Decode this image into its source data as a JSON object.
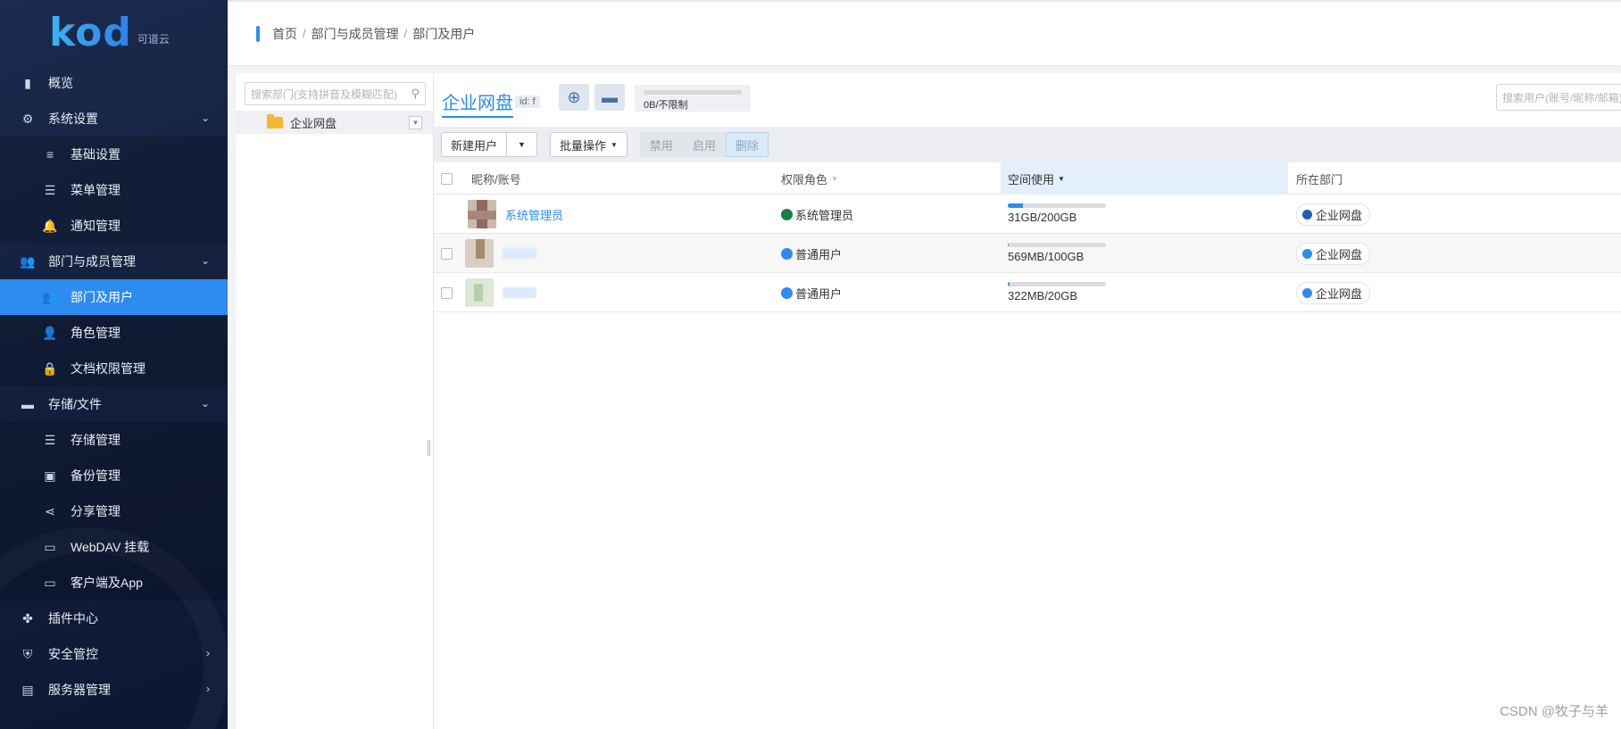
{
  "app": {
    "logo_word": "kod",
    "logo_sub": "可道云"
  },
  "sidebar": {
    "items": [
      {
        "label": "概览",
        "icon": "bar-chart-icon",
        "glyph": "▮",
        "sub": false,
        "active": false,
        "caret": ""
      },
      {
        "label": "系统设置",
        "icon": "gear-icon",
        "glyph": "⚙",
        "sub": false,
        "active": false,
        "caret": "⌄"
      },
      {
        "label": "基础设置",
        "icon": "sliders-icon",
        "glyph": "≡",
        "sub": true,
        "active": false,
        "caret": ""
      },
      {
        "label": "菜单管理",
        "icon": "menu-list-icon",
        "glyph": "☰",
        "sub": true,
        "active": false,
        "caret": ""
      },
      {
        "label": "通知管理",
        "icon": "bell-icon",
        "glyph": "🔔",
        "sub": true,
        "active": false,
        "caret": ""
      },
      {
        "label": "部门与成员管理",
        "icon": "users-icon",
        "glyph": "👥",
        "sub": false,
        "active": false,
        "caret": "⌄"
      },
      {
        "label": "部门及用户",
        "icon": "user-group-icon",
        "glyph": "👥",
        "sub": true,
        "active": true,
        "caret": ""
      },
      {
        "label": "角色管理",
        "icon": "role-user-icon",
        "glyph": "👤",
        "sub": true,
        "active": false,
        "caret": ""
      },
      {
        "label": "文档权限管理",
        "icon": "lock-icon",
        "glyph": "🔒",
        "sub": true,
        "active": false,
        "caret": ""
      },
      {
        "label": "存储/文件",
        "icon": "folder-icon",
        "glyph": "▬",
        "sub": false,
        "active": false,
        "caret": "⌄"
      },
      {
        "label": "存储管理",
        "icon": "database-icon",
        "glyph": "☰",
        "sub": true,
        "active": false,
        "caret": ""
      },
      {
        "label": "备份管理",
        "icon": "backup-icon",
        "glyph": "▣",
        "sub": true,
        "active": false,
        "caret": ""
      },
      {
        "label": "分享管理",
        "icon": "share-icon",
        "glyph": "⋖",
        "sub": true,
        "active": false,
        "caret": ""
      },
      {
        "label": "WebDAV 挂载",
        "icon": "drive-icon",
        "glyph": "▭",
        "sub": true,
        "active": false,
        "caret": ""
      },
      {
        "label": "客户端及App",
        "icon": "monitor-icon",
        "glyph": "▭",
        "sub": true,
        "active": false,
        "caret": ""
      },
      {
        "label": "插件中心",
        "icon": "plugin-icon",
        "glyph": "✤",
        "sub": false,
        "active": false,
        "caret": ""
      },
      {
        "label": "安全管控",
        "icon": "shield-icon",
        "glyph": "⛨",
        "sub": false,
        "active": false,
        "caret": "›"
      },
      {
        "label": "服务器管理",
        "icon": "server-icon",
        "glyph": "▤",
        "sub": false,
        "active": false,
        "caret": "›"
      }
    ]
  },
  "breadcrumb": {
    "items": [
      "首页",
      "部门与成员管理",
      "部门及用户"
    ],
    "separator": "/"
  },
  "tree": {
    "search_placeholder": "搜索部门(支持拼音及模糊匹配)",
    "root_label": "企业网盘"
  },
  "group": {
    "title": "企业网盘",
    "id_label": "id: f",
    "quota_text": "0B/不限制",
    "user_search_placeholder": "搜索用户(账号/昵称/邮箱)"
  },
  "toolbar": {
    "new_user": "新建用户",
    "batch": "批量操作",
    "disable": "禁用",
    "enable": "启用",
    "delete": "删除"
  },
  "table": {
    "columns": [
      "昵称/账号",
      "权限角色",
      "空间使用",
      "所在部门"
    ],
    "rows": [
      {
        "name": "系统管理员",
        "role": "系统管理员",
        "role_color": "#1a7f46",
        "space": "31GB/200GB",
        "space_used": 0.155,
        "dept": "企业网盘",
        "dept_color": "#1f5fb5"
      },
      {
        "name": "",
        "role": "普通用户",
        "role_color": "#2d8cf0",
        "space": "569MB/100GB",
        "space_used": 0.006,
        "dept": "企业网盘",
        "dept_color": "#2d8cf0"
      },
      {
        "name": "",
        "role": "普通用户",
        "role_color": "#2d8cf0",
        "space": "322MB/20GB",
        "space_used": 0.016,
        "dept": "企业网盘",
        "dept_color": "#2d8cf0"
      }
    ]
  },
  "watermark": "CSDN @牧子与羊"
}
